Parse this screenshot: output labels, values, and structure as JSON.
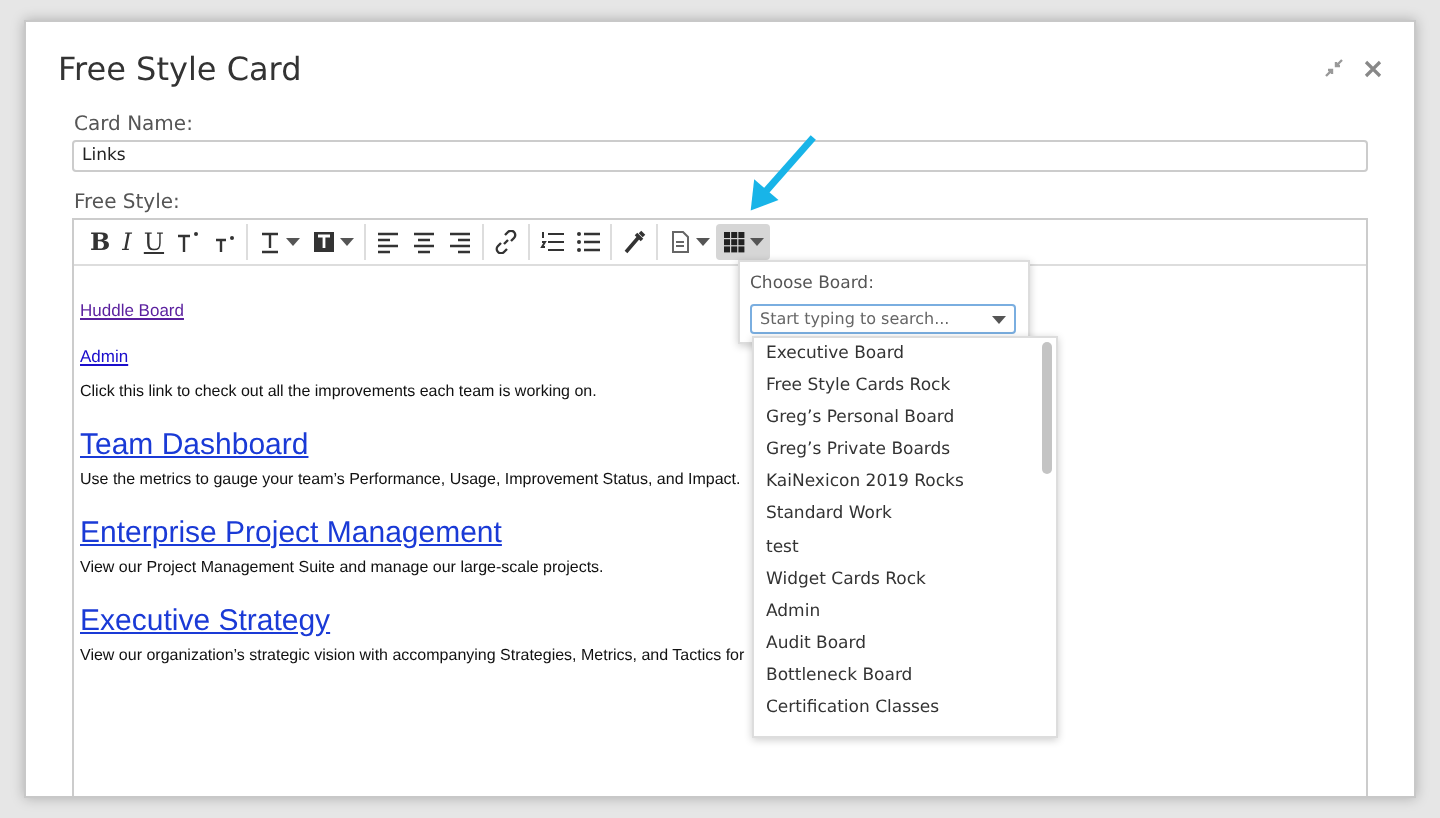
{
  "window": {
    "title": "Free Style Card"
  },
  "card_name": {
    "label": "Card Name:",
    "value": "Links"
  },
  "free_style": {
    "label": "Free Style:"
  },
  "toolbar": {
    "groups": [
      [
        {
          "kind": "bold",
          "label": "B",
          "has_menu": false,
          "selected": false
        },
        {
          "kind": "italic",
          "label": "I",
          "has_menu": false,
          "selected": false
        },
        {
          "kind": "underline",
          "label": "U",
          "has_menu": false,
          "selected": false
        },
        {
          "kind": "superscript",
          "has_menu": false,
          "selected": false
        },
        {
          "kind": "subscript",
          "has_menu": false,
          "selected": false
        }
      ],
      [
        {
          "kind": "textcolor",
          "has_menu": true,
          "selected": false
        },
        {
          "kind": "highlight",
          "has_menu": true,
          "selected": false
        }
      ],
      [
        {
          "kind": "alignleft",
          "has_menu": false,
          "selected": false
        },
        {
          "kind": "aligncenter",
          "has_menu": false,
          "selected": false
        },
        {
          "kind": "alignright",
          "has_menu": false,
          "selected": false
        }
      ],
      [
        {
          "kind": "link",
          "has_menu": false,
          "selected": false
        }
      ],
      [
        {
          "kind": "orderedlist",
          "has_menu": false,
          "selected": false
        },
        {
          "kind": "bulletlist",
          "has_menu": false,
          "selected": false
        }
      ],
      [
        {
          "kind": "clear",
          "has_menu": false,
          "selected": false
        }
      ],
      [
        {
          "kind": "template",
          "has_menu": true,
          "selected": false
        },
        {
          "kind": "board",
          "has_menu": true,
          "selected": true
        }
      ]
    ]
  },
  "content": [
    {
      "kind": "link",
      "text": "Huddle Board",
      "visited": true
    },
    {
      "kind": "link",
      "text": "Admin",
      "visited": false
    },
    {
      "kind": "text",
      "text": "Click this link to check out all the improvements each team is working on."
    },
    {
      "kind": "heading",
      "text": "Team Dashboard"
    },
    {
      "kind": "text",
      "text": "Use the metrics to gauge your team’s Performance, Usage, Improvement Status, and Impact."
    },
    {
      "kind": "heading",
      "text": "Enterprise Project Management"
    },
    {
      "kind": "text",
      "text": "View our Project Management Suite and manage our large-scale projects."
    },
    {
      "kind": "heading",
      "text": "Executive Strategy"
    },
    {
      "kind": "text",
      "text": "View our organization’s strategic vision with accompanying Strategies, Metrics, and Tactics for"
    }
  ],
  "board_picker": {
    "label": "Choose Board:",
    "placeholder": "Start typing to search...",
    "options": [
      "Executive Board",
      "Free Style Cards Rock",
      "Greg’s Personal Board",
      "Greg’s Private Boards",
      "KaiNexicon 2019 Rocks",
      "Standard Work",
      "test",
      "Widget Cards Rock",
      "Admin",
      "Audit Board",
      "Bottleneck Board",
      "Certification Classes"
    ]
  }
}
